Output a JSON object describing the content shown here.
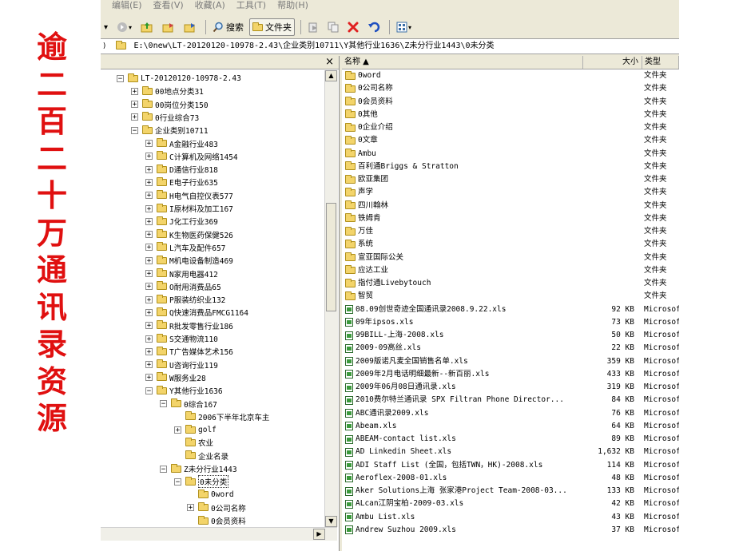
{
  "side_title": [
    "逾",
    "二",
    "百",
    "二",
    "十",
    "万",
    "通",
    "讯",
    "录",
    "资",
    "源"
  ],
  "menu": [
    "编辑(E)",
    "查看(V)",
    "收藏(A)",
    "工具(T)",
    "帮助(H)"
  ],
  "toolbar": {
    "search_label": "搜索",
    "folders_label": "文件夹"
  },
  "address": "E:\\0new\\LT-20120120-10978-2.43\\企业类别10711\\Y其他行业1636\\Z未分行业1443\\0未分类",
  "tree": {
    "close": "×",
    "items": [
      {
        "label": "LT-20120120-10978-2.43",
        "exp": "⊟",
        "indent": 0
      },
      {
        "label": "00地点分类31",
        "exp": "⊞",
        "indent": 1
      },
      {
        "label": "00岗位分类150",
        "exp": "⊞",
        "indent": 1
      },
      {
        "label": "0行业综合73",
        "exp": "⊞",
        "indent": 1
      },
      {
        "label": "企业类别10711",
        "exp": "⊟",
        "indent": 1
      },
      {
        "label": "A金融行业483",
        "exp": "⊞",
        "indent": 2
      },
      {
        "label": "C计算机及网络1454",
        "exp": "⊞",
        "indent": 2
      },
      {
        "label": "D通信行业818",
        "exp": "⊞",
        "indent": 2
      },
      {
        "label": "E电子行业635",
        "exp": "⊞",
        "indent": 2
      },
      {
        "label": "H电气自控仪表577",
        "exp": "⊞",
        "indent": 2
      },
      {
        "label": "I原材料及加工167",
        "exp": "⊞",
        "indent": 2
      },
      {
        "label": "J化工行业369",
        "exp": "⊞",
        "indent": 2
      },
      {
        "label": "K生物医药保健526",
        "exp": "⊞",
        "indent": 2
      },
      {
        "label": "L汽车及配件657",
        "exp": "⊞",
        "indent": 2
      },
      {
        "label": "M机电设备制造469",
        "exp": "⊞",
        "indent": 2
      },
      {
        "label": "N家用电器412",
        "exp": "⊞",
        "indent": 2
      },
      {
        "label": "O耐用消费品65",
        "exp": "⊞",
        "indent": 2
      },
      {
        "label": "P服装纺织业132",
        "exp": "⊞",
        "indent": 2
      },
      {
        "label": "Q快速消费品FMCG1164",
        "exp": "⊞",
        "indent": 2
      },
      {
        "label": "R批发零售行业186",
        "exp": "⊞",
        "indent": 2
      },
      {
        "label": "S交通物流110",
        "exp": "⊞",
        "indent": 2
      },
      {
        "label": "T广告媒体艺术156",
        "exp": "⊞",
        "indent": 2
      },
      {
        "label": "U咨询行业119",
        "exp": "⊞",
        "indent": 2
      },
      {
        "label": "W服务业28",
        "exp": "⊞",
        "indent": 2
      },
      {
        "label": "Y其他行业1636",
        "exp": "⊟",
        "indent": 2
      },
      {
        "label": "0综合167",
        "exp": "⊟",
        "indent": 3
      },
      {
        "label": "2006下半年北京车主",
        "exp": "",
        "indent": 4
      },
      {
        "label": "golf",
        "exp": "⊞",
        "indent": 4
      },
      {
        "label": "农业",
        "exp": "",
        "indent": 4
      },
      {
        "label": "企业名录",
        "exp": "",
        "indent": 4
      },
      {
        "label": "Z未分行业1443",
        "exp": "⊟",
        "indent": 3
      },
      {
        "label": "0未分类",
        "exp": "⊟",
        "indent": 4
      },
      {
        "label": "0word",
        "exp": "",
        "indent": 5
      },
      {
        "label": "0公司名称",
        "exp": "⊞",
        "indent": 5
      },
      {
        "label": "0会员资料",
        "exp": "",
        "indent": 5
      }
    ]
  },
  "files": {
    "headers": {
      "name": "名称 ▲",
      "size": "大小",
      "type": "类型"
    },
    "rows": [
      {
        "name": "0word",
        "size": "",
        "type": "文件夹",
        "kind": "folder"
      },
      {
        "name": "0公司名称",
        "size": "",
        "type": "文件夹",
        "kind": "folder"
      },
      {
        "name": "0会员资料",
        "size": "",
        "type": "文件夹",
        "kind": "folder"
      },
      {
        "name": "0其他",
        "size": "",
        "type": "文件夹",
        "kind": "folder"
      },
      {
        "name": "0企业介绍",
        "size": "",
        "type": "文件夹",
        "kind": "folder"
      },
      {
        "name": "0文章",
        "size": "",
        "type": "文件夹",
        "kind": "folder"
      },
      {
        "name": "Ambu",
        "size": "",
        "type": "文件夹",
        "kind": "folder"
      },
      {
        "name": "百利通Briggs & Stratton",
        "size": "",
        "type": "文件夹",
        "kind": "folder"
      },
      {
        "name": "欧亚集团",
        "size": "",
        "type": "文件夹",
        "kind": "folder"
      },
      {
        "name": "声学",
        "size": "",
        "type": "文件夹",
        "kind": "folder"
      },
      {
        "name": "四川翰林",
        "size": "",
        "type": "文件夹",
        "kind": "folder"
      },
      {
        "name": "铁姆肯",
        "size": "",
        "type": "文件夹",
        "kind": "folder"
      },
      {
        "name": "万佳",
        "size": "",
        "type": "文件夹",
        "kind": "folder"
      },
      {
        "name": "系统",
        "size": "",
        "type": "文件夹",
        "kind": "folder"
      },
      {
        "name": "宣亚国际公关",
        "size": "",
        "type": "文件夹",
        "kind": "folder"
      },
      {
        "name": "应达工业",
        "size": "",
        "type": "文件夹",
        "kind": "folder"
      },
      {
        "name": "指付通Livebytouch",
        "size": "",
        "type": "文件夹",
        "kind": "folder"
      },
      {
        "name": "智贸",
        "size": "",
        "type": "文件夹",
        "kind": "folder"
      },
      {
        "name": "08.09创世奇迹全国通讯录2008.9.22.xls",
        "size": "92 KB",
        "type": "Microsof",
        "kind": "xls"
      },
      {
        "name": "09年ipsos.xls",
        "size": "73 KB",
        "type": "Microsof",
        "kind": "xls"
      },
      {
        "name": "99BILL-上海-2008.xls",
        "size": "50 KB",
        "type": "Microsof",
        "kind": "xls"
      },
      {
        "name": "2009-09高丝.xls",
        "size": "22 KB",
        "type": "Microsof",
        "kind": "xls"
      },
      {
        "name": "2009版诺凡麦全国销售名单.xls",
        "size": "359 KB",
        "type": "Microsof",
        "kind": "xls"
      },
      {
        "name": "2009年2月电话明细最新--新百丽.xls",
        "size": "433 KB",
        "type": "Microsof",
        "kind": "xls"
      },
      {
        "name": "2009年06月08日通讯录.xls",
        "size": "319 KB",
        "type": "Microsof",
        "kind": "xls"
      },
      {
        "name": "2010费尔特兰通讯录 SPX Filtran Phone Director...",
        "size": "84 KB",
        "type": "Microsof",
        "kind": "xls"
      },
      {
        "name": "ABC通讯录2009.xls",
        "size": "76 KB",
        "type": "Microsof",
        "kind": "xls"
      },
      {
        "name": "Abeam.xls",
        "size": "64 KB",
        "type": "Microsof",
        "kind": "xls"
      },
      {
        "name": "ABEAM-contact list.xls",
        "size": "89 KB",
        "type": "Microsof",
        "kind": "xls"
      },
      {
        "name": "AD Linkedin Sheet.xls",
        "size": "1,632 KB",
        "type": "Microsof",
        "kind": "xls"
      },
      {
        "name": "ADI Staff  List (全国，包括TWN，HK)-2008.xls",
        "size": "114 KB",
        "type": "Microsof",
        "kind": "xls"
      },
      {
        "name": "Aeroflex-2008-01.xls",
        "size": "48 KB",
        "type": "Microsof",
        "kind": "xls"
      },
      {
        "name": "Aker Solutions上海 张家港Project Team-2008-03...",
        "size": "133 KB",
        "type": "Microsof",
        "kind": "xls"
      },
      {
        "name": "ALcan江阴宝柏-2009-03.xls",
        "size": "42 KB",
        "type": "Microsof",
        "kind": "xls"
      },
      {
        "name": "Ambu List.xls",
        "size": "43 KB",
        "type": "Microsof",
        "kind": "xls"
      },
      {
        "name": "Andrew Suzhou 2009.xls",
        "size": "37 KB",
        "type": "Microsof",
        "kind": "xls"
      }
    ]
  }
}
